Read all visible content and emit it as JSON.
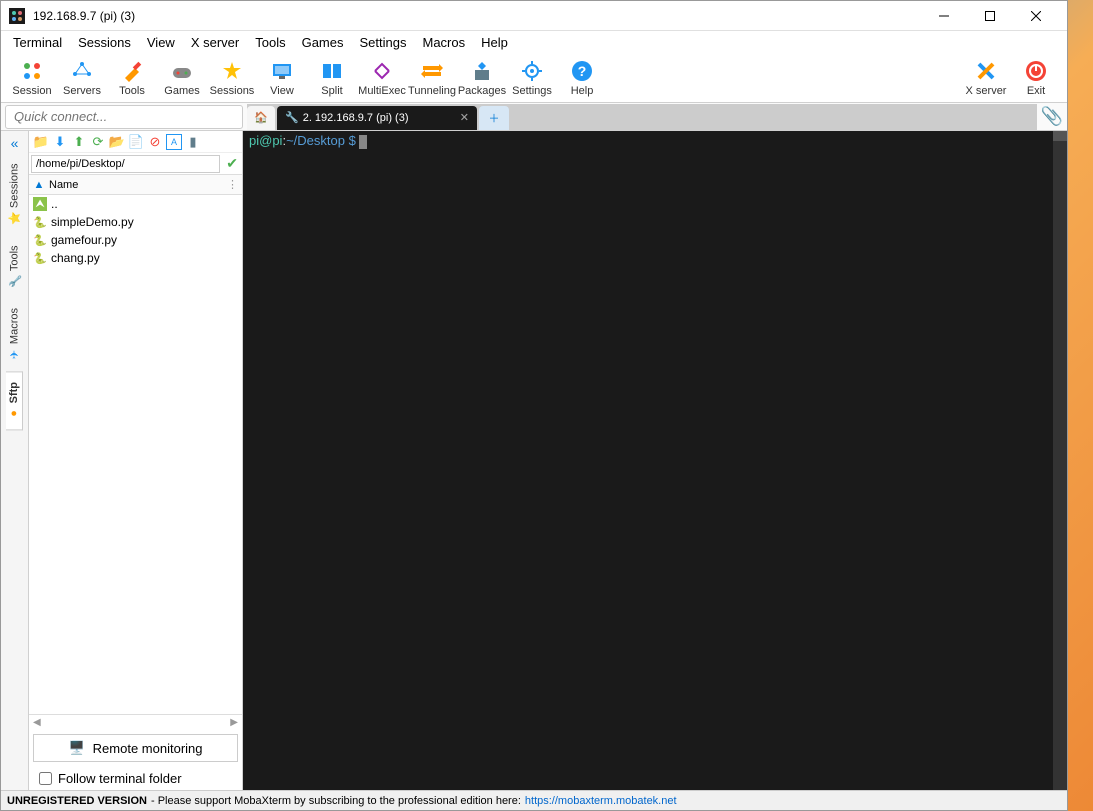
{
  "titlebar": {
    "title": "192.168.9.7 (pi) (3)"
  },
  "menubar": [
    "Terminal",
    "Sessions",
    "View",
    "X server",
    "Tools",
    "Games",
    "Settings",
    "Macros",
    "Help"
  ],
  "toolbar": {
    "left": [
      {
        "label": "Session",
        "icon": "session"
      },
      {
        "label": "Servers",
        "icon": "servers"
      },
      {
        "label": "Tools",
        "icon": "tools"
      },
      {
        "label": "Games",
        "icon": "games"
      },
      {
        "label": "Sessions",
        "icon": "star"
      },
      {
        "label": "View",
        "icon": "view"
      },
      {
        "label": "Split",
        "icon": "split"
      },
      {
        "label": "MultiExec",
        "icon": "multiexec"
      },
      {
        "label": "Tunneling",
        "icon": "tunneling"
      },
      {
        "label": "Packages",
        "icon": "packages"
      },
      {
        "label": "Settings",
        "icon": "settings"
      },
      {
        "label": "Help",
        "icon": "help"
      }
    ],
    "right": [
      {
        "label": "X server",
        "icon": "xserver"
      },
      {
        "label": "Exit",
        "icon": "exit"
      }
    ]
  },
  "quick_connect": {
    "placeholder": "Quick connect..."
  },
  "tabs": {
    "active_label": "2. 192.168.9.7 (pi) (3)"
  },
  "side_tabs": [
    "Sessions",
    "Tools",
    "Macros",
    "Sftp"
  ],
  "sftp": {
    "path": "/home/pi/Desktop/",
    "header_name": "Name",
    "files": [
      {
        "name": "..",
        "type": "up"
      },
      {
        "name": "simpleDemo.py",
        "type": "py"
      },
      {
        "name": "gamefour.py",
        "type": "py"
      },
      {
        "name": "chang.py",
        "type": "py"
      }
    ],
    "remote_monitoring": "Remote monitoring",
    "follow_terminal": "Follow terminal folder"
  },
  "terminal": {
    "user": "pi@pi",
    "sep": ":",
    "path": "~/Desktop $",
    "after": " "
  },
  "statusbar": {
    "unreg": "UNREGISTERED VERSION",
    "msg": " -  Please support MobaXterm by subscribing to the professional edition here:  ",
    "link": "https://mobaxterm.mobatek.net"
  }
}
